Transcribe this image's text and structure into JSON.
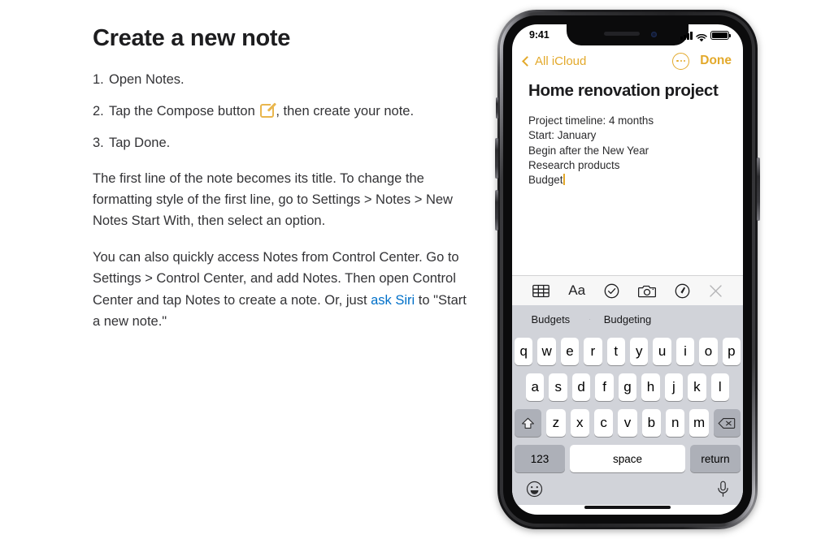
{
  "doc": {
    "title": "Create a new note",
    "steps": [
      {
        "num": "1.",
        "text_before": "Open Notes.",
        "icon": null,
        "text_after": ""
      },
      {
        "num": "2.",
        "text_before": "Tap the Compose button ",
        "icon": "compose-icon",
        "text_after": ", then create your note."
      },
      {
        "num": "3.",
        "text_before": "Tap Done.",
        "icon": null,
        "text_after": ""
      }
    ],
    "paragraph1": "The first line of the note becomes its title. To change the formatting style of the first line, go to Settings > Notes > New Notes Start With, then select an option.",
    "paragraph2_before": "You can also quickly access Notes from Control Center. Go to Settings > Control Center, and add Notes. Then open Control Center and tap Notes to create a note. Or, just ",
    "paragraph2_link": "ask Siri",
    "paragraph2_after": " to \"Start a new note.\"",
    "link_color": "#0070c9",
    "accent_color": "#e3a92b"
  },
  "phone": {
    "statusbar": {
      "time": "9:41",
      "signal_icon": "cellular-signal-icon",
      "wifi_icon": "wifi-icon",
      "battery_icon": "battery-icon",
      "battery_level_percent": 100
    },
    "navbar": {
      "back_label": "All iCloud",
      "back_icon": "chevron-left-icon",
      "more_icon": "more-ellipsis-circle-icon",
      "done_label": "Done"
    },
    "note": {
      "title": "Home renovation project",
      "lines": [
        "Project timeline: 4 months",
        "Start: January",
        "Begin after the New Year",
        "Research products",
        "Budget"
      ],
      "caret_after_line": 4,
      "caret_color": "#e3a92b"
    },
    "format_toolbar": [
      {
        "name": "table-icon",
        "label": ""
      },
      {
        "name": "text-format-icon",
        "label": "Aa"
      },
      {
        "name": "checklist-icon",
        "label": ""
      },
      {
        "name": "camera-icon",
        "label": ""
      },
      {
        "name": "markup-pen-icon",
        "label": ""
      },
      {
        "name": "close-icon",
        "label": ""
      }
    ],
    "keyboard": {
      "predictive": [
        "Budgets",
        "Budgeting",
        ""
      ],
      "row1": [
        "q",
        "w",
        "e",
        "r",
        "t",
        "y",
        "u",
        "i",
        "o",
        "p"
      ],
      "row2": [
        "a",
        "s",
        "d",
        "f",
        "g",
        "h",
        "j",
        "k",
        "l"
      ],
      "row3_letters": [
        "z",
        "x",
        "c",
        "v",
        "b",
        "n",
        "m"
      ],
      "shift_icon": "shift-arrow-icon",
      "backspace_icon": "backspace-delete-icon",
      "numbers_label": "123",
      "space_label": "space",
      "return_label": "return",
      "emoji_icon": "emoji-smiley-icon",
      "dictation_icon": "microphone-icon"
    },
    "home_indicator": "home-indicator-bar"
  }
}
